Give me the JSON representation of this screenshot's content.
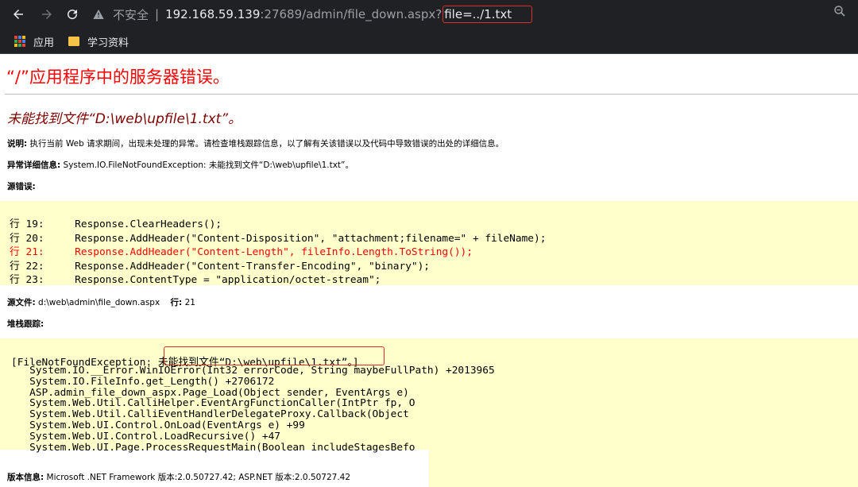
{
  "browser": {
    "insecure_label": "不安全",
    "separator": "|",
    "host": "192.168.59.139",
    "path": ":27689/admin/file_down.aspx?",
    "query": "file=../1.txt"
  },
  "bookmarks": [
    {
      "label": "应用",
      "icon": "apps-grid-icon"
    },
    {
      "label": "学习资料",
      "icon": "folder-icon"
    }
  ],
  "page": {
    "title": "“/”应用程序中的服务器错误。",
    "error_message": "未能找到文件“D:\\web\\upfile\\1.txt”。",
    "description_label": "说明:",
    "description_text": " 执行当前 Web 请求期间，出现未处理的异常。请检查堆栈跟踪信息，以了解有关该错误以及代码中导致错误的出处的详细信息。",
    "exception_label": "异常详细信息:",
    "exception_text": " System.IO.FileNotFoundException: 未能找到文件“D:\\web\\upfile\\1.txt”。",
    "source_error_label": "源错误:",
    "source_lines": [
      {
        "prefix": "行 19:",
        "code": "Response.ClearHeaders();",
        "error": false
      },
      {
        "prefix": "行 20:",
        "code": "Response.AddHeader(\"Content-Disposition\", \"attachment;filename=\" + fileName);",
        "error": false
      },
      {
        "prefix": "行 21:",
        "code": "Response.AddHeader(\"Content-Length\", fileInfo.Length.ToString());",
        "error": true
      },
      {
        "prefix": "行 22:",
        "code": "Response.AddHeader(\"Content-Transfer-Encoding\", \"binary\");",
        "error": false
      },
      {
        "prefix": "行 23:",
        "code": "Response.ContentType = \"application/octet-stream\";",
        "error": false
      }
    ],
    "source_file_label": "源文件:",
    "source_file_value": " d:\\web\\admin\\file_down.aspx",
    "line_label": "行:",
    "line_value": " 21",
    "stack_label": "堆栈跟踪:",
    "stack_head_prefix": "[FileNotFoundException: ",
    "stack_head_msg": "未能找到文件“D:\\web\\upfile\\1.txt”。]",
    "stack_lines": [
      "   System.IO.__Error.WinIOError(Int32 errorCode, String maybeFullPath) +2013965",
      "   System.IO.FileInfo.get_Length() +2706172",
      "   ASP.admin_file_down_aspx.Page_Load(Object sender, EventArgs e)",
      "   System.Web.Util.CalliHelper.EventArgFunctionCaller(IntPtr fp, O",
      "   System.Web.Util.CalliEventHandlerDelegateProxy.Callback(Object",
      "   System.Web.UI.Control.OnLoad(EventArgs e) +99",
      "   System.Web.UI.Control.LoadRecursive() +47",
      "   System.Web.UI.Page.ProcessRequestMain(Boolean includeStagesBefo"
    ],
    "version_label": "版本信息:",
    "version_text": " Microsoft .NET Framework 版本:2.0.50727.42; ASP.NET 版本:2.0.50727.42"
  }
}
